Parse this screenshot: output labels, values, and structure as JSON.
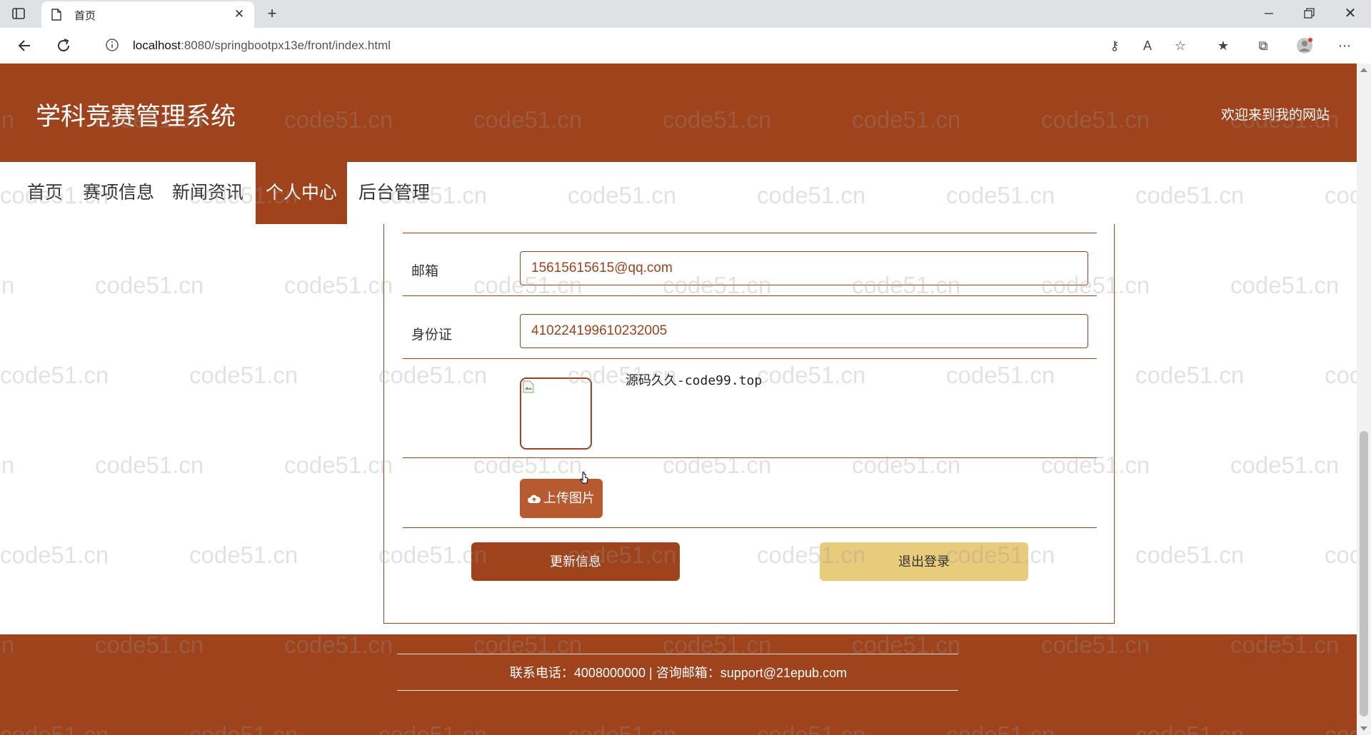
{
  "browser": {
    "tab_title": "首页",
    "url_host": "localhost",
    "url_rest": ":8080/springbootpx13e/front/index.html"
  },
  "site": {
    "title": "学科竞赛管理系统",
    "welcome": "欢迎来到我的网站"
  },
  "nav": {
    "items": [
      "首页",
      "赛项信息",
      "新闻资讯",
      "个人中心",
      "后台管理"
    ],
    "active": "个人中心"
  },
  "form": {
    "email_label": "邮箱",
    "email_value": "15615615615@qq.com",
    "idcard_label": "身份证",
    "idcard_value": "410224199610232005",
    "upload_label": "上传图片",
    "update_label": "更新信息",
    "logout_label": "退出登录"
  },
  "overlay_text": "源码久久-code99.top",
  "footer": {
    "text": "联系电话：4008000000 | 咨询邮箱：support@21epub.com"
  },
  "watermark": "code51.cn",
  "colors": {
    "primary": "#9e431c",
    "upload": "#b75a30",
    "logout": "#e9cb7c"
  }
}
